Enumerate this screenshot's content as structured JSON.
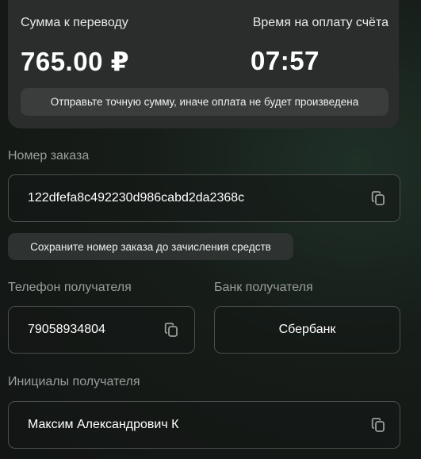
{
  "summary": {
    "amount_label": "Сумма к переводу",
    "amount_value": "765.00 ₽",
    "time_label": "Время на оплату счёта",
    "time_value": "07:57",
    "warning": "Отправьте точную сумму, иначе оплата не будет произведена"
  },
  "order": {
    "label": "Номер заказа",
    "value": "122dfefa8c492230d986cabd2da2368c",
    "hint": "Сохраните номер заказа до зачисления средств"
  },
  "recipient_phone": {
    "label": "Телефон получателя",
    "value": "79058934804"
  },
  "recipient_bank": {
    "label": "Банк получателя",
    "value": "Сбербанк"
  },
  "recipient_initials": {
    "label": "Инициалы получателя",
    "value": "Максим Александрович К"
  },
  "icons": {
    "copy": "copy-icon"
  },
  "colors": {
    "card_bg": "#2a2d2c",
    "pill_bg": "#3a3d3c",
    "label_gray": "#9a9e9c",
    "field_border": "#4a4e4c"
  }
}
